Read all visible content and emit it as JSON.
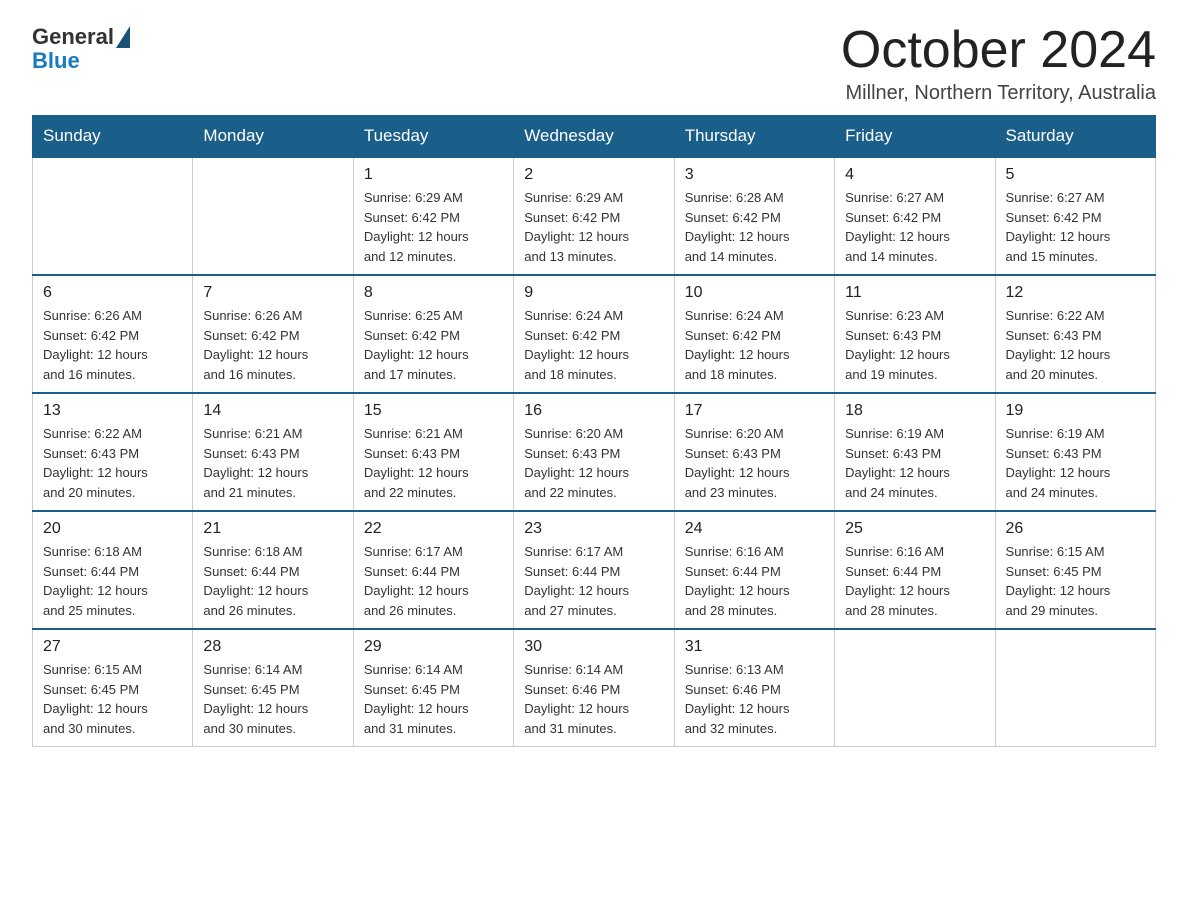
{
  "header": {
    "logo_general": "General",
    "logo_blue": "Blue",
    "title": "October 2024",
    "location": "Millner, Northern Territory, Australia"
  },
  "columns": [
    "Sunday",
    "Monday",
    "Tuesday",
    "Wednesday",
    "Thursday",
    "Friday",
    "Saturday"
  ],
  "weeks": [
    [
      {
        "day": "",
        "info": ""
      },
      {
        "day": "",
        "info": ""
      },
      {
        "day": "1",
        "info": "Sunrise: 6:29 AM\nSunset: 6:42 PM\nDaylight: 12 hours\nand 12 minutes."
      },
      {
        "day": "2",
        "info": "Sunrise: 6:29 AM\nSunset: 6:42 PM\nDaylight: 12 hours\nand 13 minutes."
      },
      {
        "day": "3",
        "info": "Sunrise: 6:28 AM\nSunset: 6:42 PM\nDaylight: 12 hours\nand 14 minutes."
      },
      {
        "day": "4",
        "info": "Sunrise: 6:27 AM\nSunset: 6:42 PM\nDaylight: 12 hours\nand 14 minutes."
      },
      {
        "day": "5",
        "info": "Sunrise: 6:27 AM\nSunset: 6:42 PM\nDaylight: 12 hours\nand 15 minutes."
      }
    ],
    [
      {
        "day": "6",
        "info": "Sunrise: 6:26 AM\nSunset: 6:42 PM\nDaylight: 12 hours\nand 16 minutes."
      },
      {
        "day": "7",
        "info": "Sunrise: 6:26 AM\nSunset: 6:42 PM\nDaylight: 12 hours\nand 16 minutes."
      },
      {
        "day": "8",
        "info": "Sunrise: 6:25 AM\nSunset: 6:42 PM\nDaylight: 12 hours\nand 17 minutes."
      },
      {
        "day": "9",
        "info": "Sunrise: 6:24 AM\nSunset: 6:42 PM\nDaylight: 12 hours\nand 18 minutes."
      },
      {
        "day": "10",
        "info": "Sunrise: 6:24 AM\nSunset: 6:42 PM\nDaylight: 12 hours\nand 18 minutes."
      },
      {
        "day": "11",
        "info": "Sunrise: 6:23 AM\nSunset: 6:43 PM\nDaylight: 12 hours\nand 19 minutes."
      },
      {
        "day": "12",
        "info": "Sunrise: 6:22 AM\nSunset: 6:43 PM\nDaylight: 12 hours\nand 20 minutes."
      }
    ],
    [
      {
        "day": "13",
        "info": "Sunrise: 6:22 AM\nSunset: 6:43 PM\nDaylight: 12 hours\nand 20 minutes."
      },
      {
        "day": "14",
        "info": "Sunrise: 6:21 AM\nSunset: 6:43 PM\nDaylight: 12 hours\nand 21 minutes."
      },
      {
        "day": "15",
        "info": "Sunrise: 6:21 AM\nSunset: 6:43 PM\nDaylight: 12 hours\nand 22 minutes."
      },
      {
        "day": "16",
        "info": "Sunrise: 6:20 AM\nSunset: 6:43 PM\nDaylight: 12 hours\nand 22 minutes."
      },
      {
        "day": "17",
        "info": "Sunrise: 6:20 AM\nSunset: 6:43 PM\nDaylight: 12 hours\nand 23 minutes."
      },
      {
        "day": "18",
        "info": "Sunrise: 6:19 AM\nSunset: 6:43 PM\nDaylight: 12 hours\nand 24 minutes."
      },
      {
        "day": "19",
        "info": "Sunrise: 6:19 AM\nSunset: 6:43 PM\nDaylight: 12 hours\nand 24 minutes."
      }
    ],
    [
      {
        "day": "20",
        "info": "Sunrise: 6:18 AM\nSunset: 6:44 PM\nDaylight: 12 hours\nand 25 minutes."
      },
      {
        "day": "21",
        "info": "Sunrise: 6:18 AM\nSunset: 6:44 PM\nDaylight: 12 hours\nand 26 minutes."
      },
      {
        "day": "22",
        "info": "Sunrise: 6:17 AM\nSunset: 6:44 PM\nDaylight: 12 hours\nand 26 minutes."
      },
      {
        "day": "23",
        "info": "Sunrise: 6:17 AM\nSunset: 6:44 PM\nDaylight: 12 hours\nand 27 minutes."
      },
      {
        "day": "24",
        "info": "Sunrise: 6:16 AM\nSunset: 6:44 PM\nDaylight: 12 hours\nand 28 minutes."
      },
      {
        "day": "25",
        "info": "Sunrise: 6:16 AM\nSunset: 6:44 PM\nDaylight: 12 hours\nand 28 minutes."
      },
      {
        "day": "26",
        "info": "Sunrise: 6:15 AM\nSunset: 6:45 PM\nDaylight: 12 hours\nand 29 minutes."
      }
    ],
    [
      {
        "day": "27",
        "info": "Sunrise: 6:15 AM\nSunset: 6:45 PM\nDaylight: 12 hours\nand 30 minutes."
      },
      {
        "day": "28",
        "info": "Sunrise: 6:14 AM\nSunset: 6:45 PM\nDaylight: 12 hours\nand 30 minutes."
      },
      {
        "day": "29",
        "info": "Sunrise: 6:14 AM\nSunset: 6:45 PM\nDaylight: 12 hours\nand 31 minutes."
      },
      {
        "day": "30",
        "info": "Sunrise: 6:14 AM\nSunset: 6:46 PM\nDaylight: 12 hours\nand 31 minutes."
      },
      {
        "day": "31",
        "info": "Sunrise: 6:13 AM\nSunset: 6:46 PM\nDaylight: 12 hours\nand 32 minutes."
      },
      {
        "day": "",
        "info": ""
      },
      {
        "day": "",
        "info": ""
      }
    ]
  ]
}
